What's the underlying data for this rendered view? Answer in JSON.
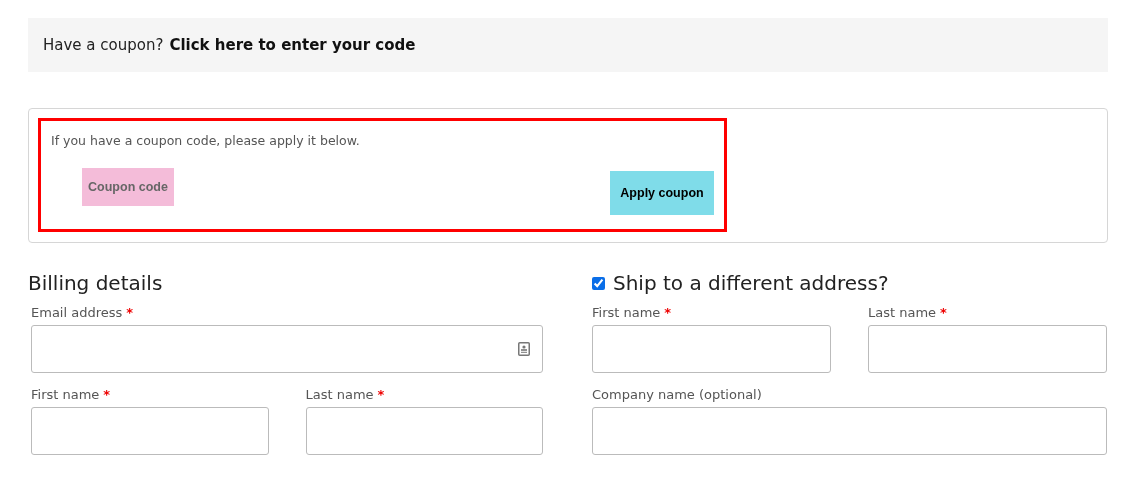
{
  "notice": {
    "text": "Have a coupon?",
    "link": "Click here to enter your code"
  },
  "coupon_form": {
    "hint": "If you have a coupon code, please apply it below.",
    "annotated": true,
    "field": {
      "placeholder": "Coupon code",
      "color": "#f4bcd9"
    },
    "button": {
      "label": "Apply coupon",
      "color": "#7fdce9"
    }
  },
  "billing": {
    "title": "Billing details",
    "fields": [
      {
        "label": "Email address",
        "required_mark": "*",
        "kind": "full",
        "contact_icon": true
      },
      {
        "label": "First name",
        "required_mark": "*",
        "kind": "half"
      },
      {
        "label": "Last name",
        "required_mark": "*",
        "kind": "half"
      }
    ]
  },
  "shipping": {
    "title": "Ship to a different address?",
    "checked": true,
    "fields": [
      {
        "label": "First name",
        "required_mark": "*",
        "kind": "half"
      },
      {
        "label": "Last name",
        "required_mark": "*",
        "kind": "half"
      },
      {
        "label": "Company name (optional)",
        "kind": "full"
      }
    ]
  }
}
